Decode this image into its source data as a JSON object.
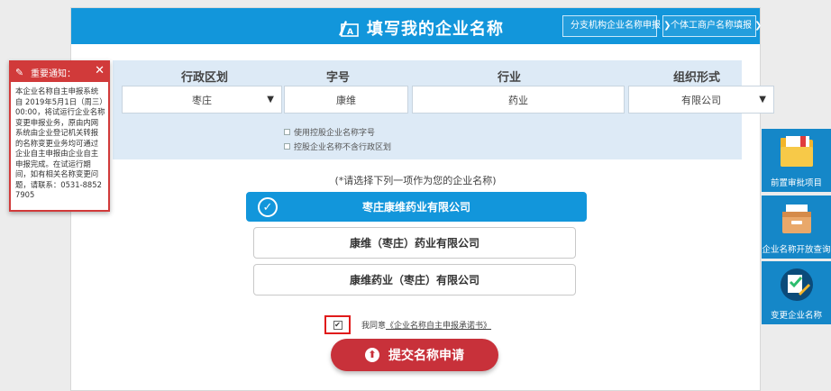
{
  "header": {
    "title": "填写我的企业名称",
    "button_branch": "分支机构企业名称申报",
    "button_individual": "个体工商户名称填报"
  },
  "form": {
    "labels": {
      "region": "行政区划",
      "brand": "字号",
      "industry": "行业",
      "org_form": "组织形式"
    },
    "values": {
      "region": "枣庄",
      "brand": "康维",
      "industry": "药业",
      "org_form": "有限公司"
    },
    "options": {
      "use_holding_brand": "使用控股企业名称字号",
      "holding_no_region": "控股企业名称不含行政区划"
    }
  },
  "prompt": "(*请选择下列一项作为您的企业名称)",
  "names": [
    "枣庄康维药业有限公司",
    "康维（枣庄）药业有限公司",
    "康维药业（枣庄）有限公司"
  ],
  "agreement": {
    "prefix": "我同意",
    "link": "《企业名称自主申报承诺书》",
    "checked_mark": "✔"
  },
  "submit_label": "提交名称申请",
  "notice": {
    "title": "重要通知：",
    "body": "本企业名称自主申报系统自 2019年5月1日（周三）00:00，将试运行企业名称变更申报业务，原由内网系统由企业登记机关转报的名称变更业务均可通过企业自主申报由企业自主申报完成。在试运行期间，如有相关名称变更问题，请联系：0531-88527905"
  },
  "side_tiles": [
    {
      "label": "前置审批项目",
      "icon": "folder-icon"
    },
    {
      "label": "企业名称开放查询",
      "icon": "archive-box-icon"
    },
    {
      "label": "变更企业名称",
      "icon": "edit-check-icon"
    }
  ],
  "colors": {
    "primary_blue": "#1296db",
    "panel_blue": "#ddeaf6",
    "submit_red": "#c8313a",
    "notice_red": "#d13a3a"
  }
}
